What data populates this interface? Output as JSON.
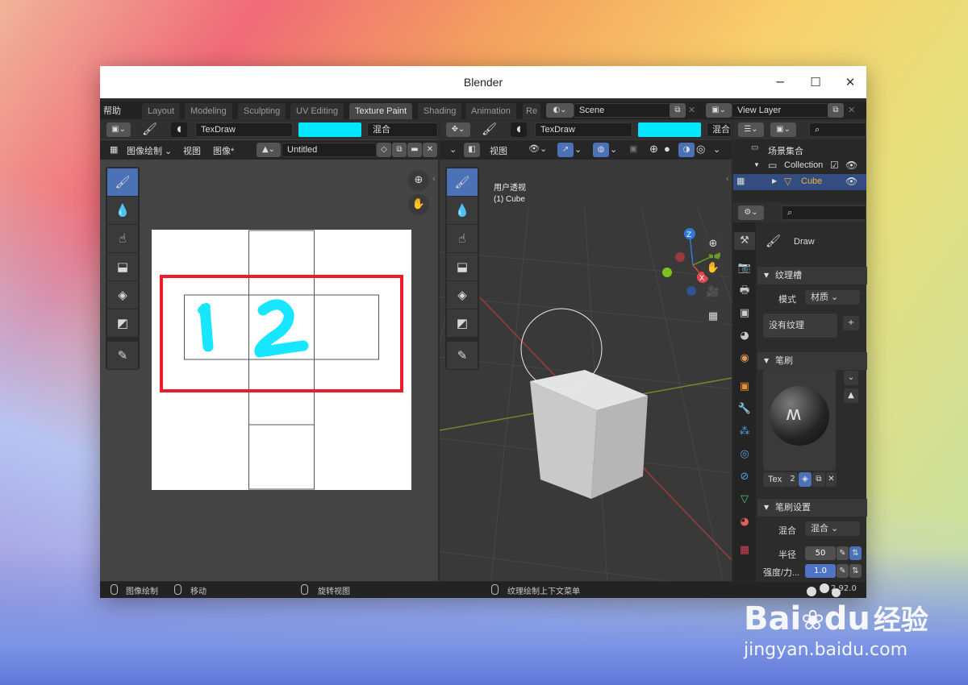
{
  "window": {
    "title": "Blender",
    "controls": {
      "minimize": "─",
      "maximize": "☐",
      "close": "✕"
    }
  },
  "topbar": {
    "help": "帮助",
    "tabs": [
      "Layout",
      "Modeling",
      "Sculpting",
      "UV Editing",
      "Texture Paint",
      "Shading",
      "Animation",
      "Re"
    ],
    "active_tab": "Texture Paint",
    "scene": "Scene",
    "view_layer": "View Layer"
  },
  "image_editor": {
    "brush": "TexDraw",
    "color": "#00e7ff",
    "blend": "混合",
    "mode": "图像绘制",
    "menu_view": "视图",
    "menu_image": "图像*",
    "image_name": "Untitled"
  },
  "viewport": {
    "brush": "TexDraw",
    "color": "#00e7ff",
    "blend": "混合",
    "menu_view": "视图",
    "overlay_title": "用户透视",
    "overlay_subtitle": "(1) Cube",
    "axes": {
      "z": "Z",
      "y": "Y",
      "x": "X"
    }
  },
  "outliner": {
    "scene_collection": "场景集合",
    "collection": "Collection",
    "object": "Cube"
  },
  "properties": {
    "brush_name": "Draw",
    "texture_slots": "纹理槽",
    "mode_label": "模式",
    "mode_value": "材质",
    "no_texture": "没有纹理",
    "add": "+",
    "brush_section": "笔刷",
    "texture_field": "Tex",
    "texture_users": "2",
    "brush_settings": "笔刷设置",
    "blend_label": "混合",
    "blend_value": "混合",
    "radius_label": "半径",
    "radius_value": "50",
    "strength_label": "强度/力...",
    "strength_value": "1.0"
  },
  "statusbar": {
    "item1": "图像绘制",
    "item2": "移动",
    "item3": "旋转视图",
    "item4": "纹理绘制上下文菜单",
    "version": "2.92.0"
  },
  "watermark": {
    "brand": "Bai",
    "brand2": "du",
    "brand3": "经验",
    "url": "jingyan.baidu.com"
  }
}
